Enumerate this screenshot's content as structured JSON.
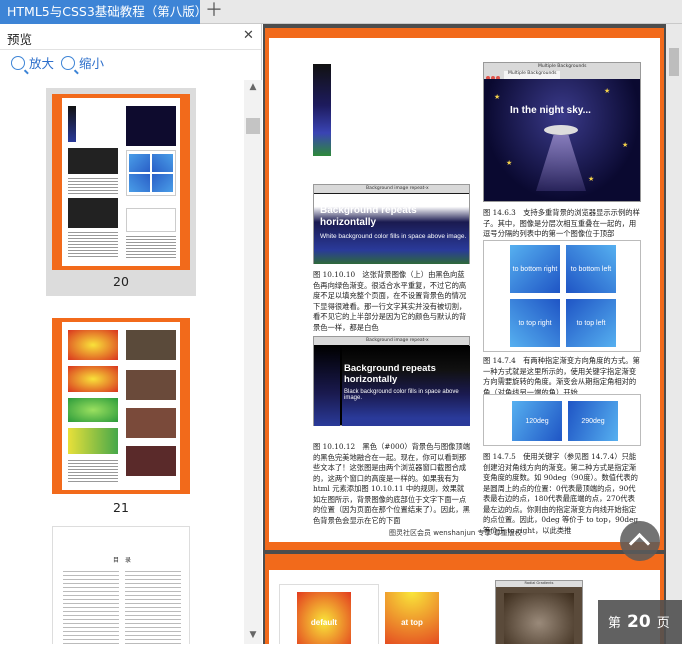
{
  "tab": {
    "title": "HTML5与CSS3基础教程（第八版）"
  },
  "sidebar": {
    "title": "预览",
    "zoom_in": "放大",
    "zoom_out": "缩小",
    "thumbnails": [
      {
        "label": "20"
      },
      {
        "label": "21"
      }
    ],
    "toc_title": "目　录"
  },
  "page": {
    "fig1_title": "Background image repeat-x",
    "fig1_big": "Background repeats horizontally",
    "fig1_small": "White background color fills in space above image.",
    "fig1_caption": "图 10.10.10　这张背景图像（上）由黑色向蓝色再向绿色渐变。很适合水平重复，不过它的高度不足以填充整个页面，在不设置背景色的情况下显得很难看。那一行文字其实并没有被切割，看不见它的上半部分是因为它的颜色与默认的背景色一样，都是白色",
    "fig2_title": "Background image repeat-x",
    "fig2_big": "Background repeats horizontally",
    "fig2_small": "Black background color fills in space above image.",
    "fig2_caption": "图 10.10.12　黑色（#000）背景色与图像顶端的黑色完美地融合在一起。现在，你可以看到那些文本了！这张图是由两个浏览器窗口截图合成的，这两个窗口的高度是一样的。如果我有为 html 元素添加图 10.10.11 中的规则，效果就如左图所示，背景图像的底部位于文字下面一点的位置（因为页面在那个位置结束了）。因此，黑色背景色会显示在它的下面",
    "fig3_title": "Multiple Backgrounds",
    "fig3_tab": "Multiple Backgrounds",
    "fig3_text": "In the night sky...",
    "fig3_caption": "图 14.6.3　支持多重背景的浏览器显示示例的样子。其中，图像是分层次相互重叠在一起的，用逗号分隔的列表中的第一个图像位于顶部",
    "grad_labels": [
      "to bottom right",
      "to bottom left",
      "to top right",
      "to top left"
    ],
    "fig4_caption": "图 14.7.4　有两种指定渐变方向角度的方式。第一种方式就是这里所示的，使用关键字指定渐变方向需要旋转的角度。渐变会从期指定角相对的角（对角线另一端的角）开始",
    "deg_labels": [
      "120deg",
      "290deg"
    ],
    "fig5_caption": "图 14.7.5　使用关键字（参见图 14.7.4）只能创建沿对角线方向的渐变。第二种方式是指定渐变角度的度数。如 90deg（90度）。数值代表的是圆周上的点的位置：0代表最顶端的点，90代表最右边的点，180代表最底端的点，270代表最左边的点。你则由的指定渐变方向线开始指定的点位置。因此，0deg 等价于 to top，90deg 等价于 to right，以此类推",
    "footer": "图灵社区会员 wenshanjun 专享 尊重版权",
    "page2_labels": [
      "default",
      "at top"
    ],
    "page2_title": "Radial Gradients"
  },
  "pager": {
    "prefix": "第",
    "number": "20",
    "suffix": "页"
  },
  "colors": {
    "accent": "#3d84d6",
    "page_border": "#f26a1b"
  }
}
